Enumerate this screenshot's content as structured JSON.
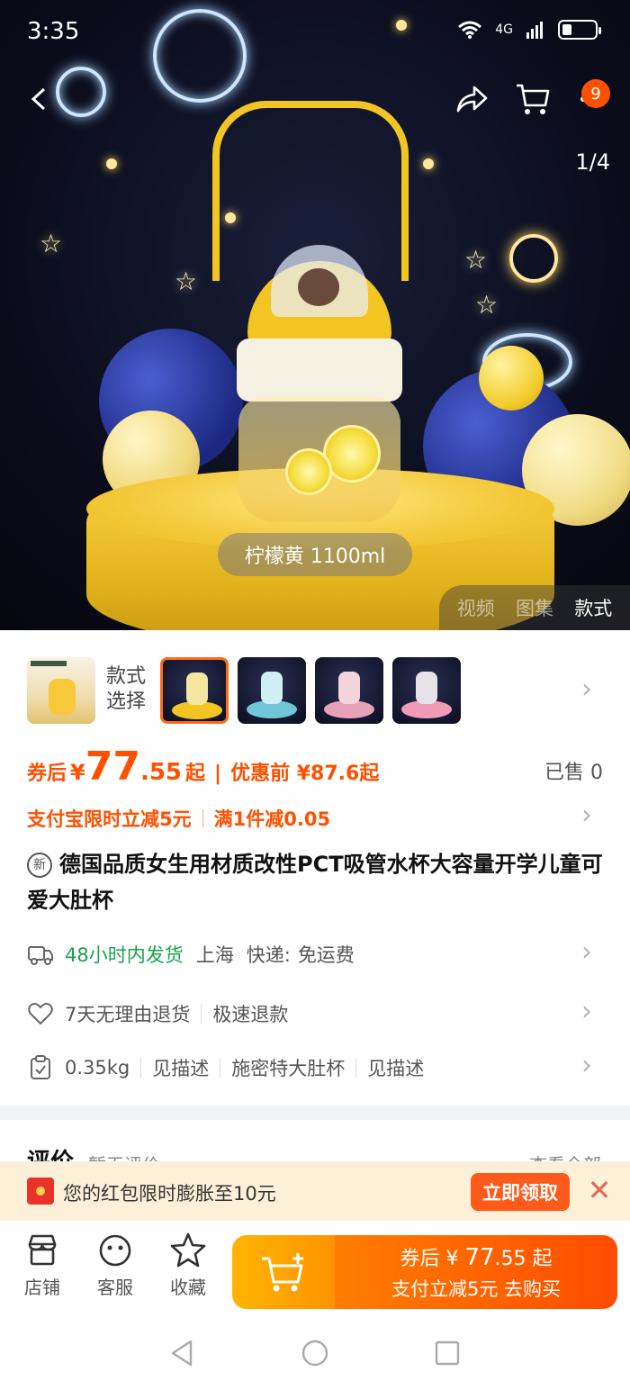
{
  "status_bar": {
    "time": "3:35",
    "network": "4G"
  },
  "header": {
    "cart_badge": "9",
    "image_pager": "1/4"
  },
  "hero": {
    "variant_label": "柠檬黄 1100ml",
    "media_tabs": [
      {
        "label": "视频",
        "active": false
      },
      {
        "label": "图集",
        "active": false
      },
      {
        "label": "款式",
        "active": true
      }
    ]
  },
  "styles": {
    "label_line1": "款式",
    "label_line2": "选择",
    "thumbs": [
      {
        "name": "style-thumb-white",
        "selected": false,
        "color": "#f0ddb0"
      },
      {
        "name": "style-thumb-yellow",
        "selected": true,
        "color": "#f3c523"
      },
      {
        "name": "style-thumb-blue",
        "selected": false,
        "color": "#6fc7d8"
      },
      {
        "name": "style-thumb-pink",
        "selected": false,
        "color": "#e8a2b7"
      },
      {
        "name": "style-thumb-pink-2",
        "selected": false,
        "color": "#f29bb8"
      }
    ]
  },
  "price": {
    "after_label": "券后",
    "yen": "¥",
    "integer": "77",
    "decimal": ".55",
    "qi": "起",
    "separator": "|",
    "before": "优惠前 ¥87.6起",
    "sold": "已售 0"
  },
  "promos": {
    "alipay": "支付宝限时立减5元",
    "full": "满1件减0.05"
  },
  "product": {
    "new_tag": "新",
    "title": "德国品质女生用材质改性PCT吸管水杯大容量开学儿童可爱大肚杯"
  },
  "shipping": {
    "dispatch": "48小时内发货",
    "origin": "上海",
    "express_label": "快递:",
    "fee": "免运费"
  },
  "service": {
    "returns": "7天无理由退货",
    "refund": "极速退款"
  },
  "params": {
    "weight": "0.35kg",
    "see1": "见描述",
    "brand": "施密特大肚杯",
    "see2": "见描述"
  },
  "reviews": {
    "title": "评价",
    "subtitle": "暂无评价",
    "more": "查看全部"
  },
  "banner": {
    "text": "您的红包限时膨胀至10元",
    "claim": "立即领取"
  },
  "bottom_bar": {
    "shop": "店铺",
    "service": "客服",
    "favorite": "收藏",
    "buy_line1_prefix": "券后 ¥ ",
    "buy_line1_int": "77",
    "buy_line1_dec": ".55",
    "buy_line1_suffix": " 起",
    "buy_line2": "支付立减5元 去购买"
  },
  "colors": {
    "accent": "#ff5000",
    "green": "#16a34a",
    "banner_bg": "#fdf0d8"
  }
}
